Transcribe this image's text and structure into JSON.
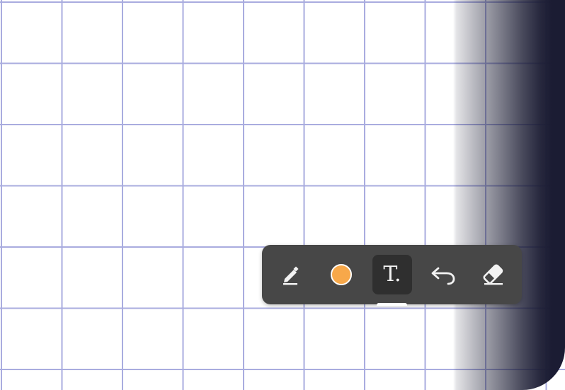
{
  "app": {
    "canvas": {
      "background": "#ffffff",
      "grid_line_color": "#a9acdf"
    },
    "edge_shade_color": "#1b1c33"
  },
  "toolbar": {
    "background": "#474747",
    "tools": [
      {
        "name": "pencil",
        "icon": "pencil-icon",
        "active": false
      },
      {
        "name": "color",
        "icon": "color-swatch",
        "color": "#f7a84a",
        "active": false
      },
      {
        "name": "text",
        "icon": "text-icon",
        "label": "T.",
        "active": true
      },
      {
        "name": "undo",
        "icon": "undo-icon",
        "active": false
      },
      {
        "name": "eraser",
        "icon": "eraser-icon",
        "active": false
      }
    ]
  }
}
